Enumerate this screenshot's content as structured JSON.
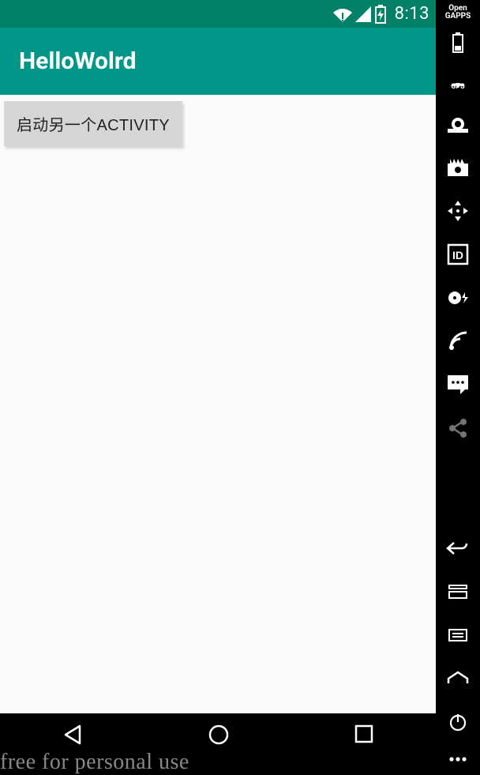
{
  "status": {
    "time": "8:13"
  },
  "app": {
    "title": "HelloWolrd"
  },
  "main": {
    "button_label": "启动另一个ACTIVITY"
  },
  "watermark": "free for personal use",
  "sidebar": {
    "open_gapps_line1": "Open",
    "open_gapps_line2": "GAPPS",
    "gps_label": "GPS",
    "id_label": "ID"
  }
}
